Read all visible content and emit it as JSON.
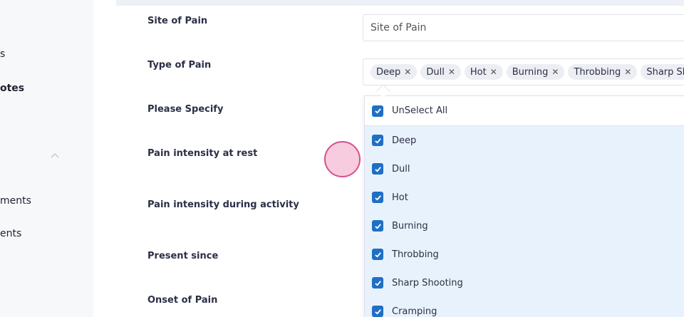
{
  "sidebar": {
    "items": [
      {
        "label": "s",
        "bold": false
      },
      {
        "label": "otes",
        "bold": true
      },
      {
        "label": "ments",
        "bold": false
      },
      {
        "label": "ents",
        "bold": false
      }
    ]
  },
  "form": {
    "site_of_pain": {
      "label": "Site of Pain",
      "placeholder": "Site of Pain"
    },
    "type_of_pain": {
      "label": "Type of Pain",
      "tags": [
        "Deep",
        "Dull",
        "Hot",
        "Burning",
        "Throbbing",
        "Sharp Shooting"
      ]
    },
    "please_specify": {
      "label": "Please Specify"
    },
    "pain_rest": {
      "label": "Pain intensity at rest"
    },
    "pain_activity": {
      "label": "Pain intensity during activity"
    },
    "present_since": {
      "label": "Present since"
    },
    "onset_of_pain": {
      "label": "Onset of Pain"
    }
  },
  "dropdown": {
    "unselect_all": "UnSelect All",
    "options": [
      {
        "label": "Deep",
        "checked": true
      },
      {
        "label": "Dull",
        "checked": true
      },
      {
        "label": "Hot",
        "checked": true
      },
      {
        "label": "Burning",
        "checked": true
      },
      {
        "label": "Throbbing",
        "checked": true
      },
      {
        "label": "Sharp Shooting",
        "checked": true
      },
      {
        "label": "Cramping",
        "checked": true
      }
    ]
  },
  "colors": {
    "accent": "#1f6fc5",
    "dropdown_bg": "#e8f2fc",
    "touch_ring": "#d94f8f"
  }
}
